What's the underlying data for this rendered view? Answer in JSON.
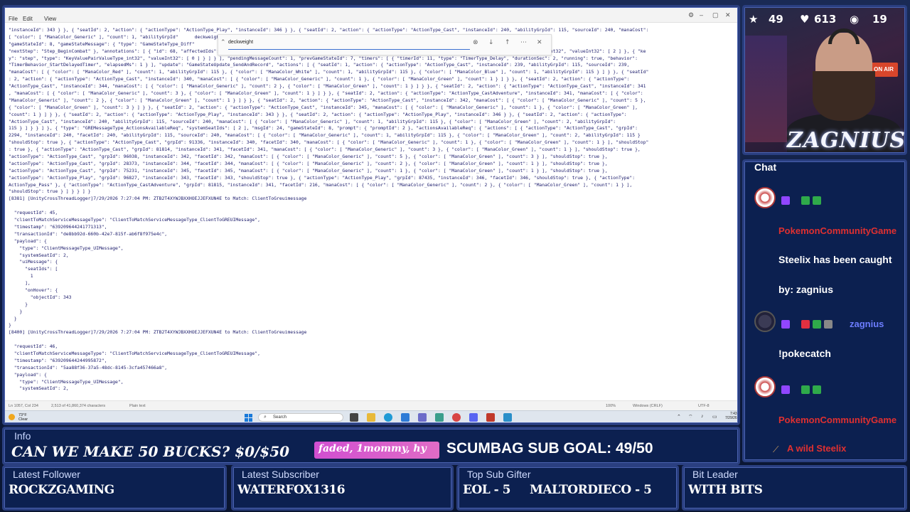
{
  "stream": {
    "stats": {
      "stars": "49",
      "hearts": "613",
      "viewers": "19"
    },
    "cam": {
      "neon_sign": "ZAGNIUS",
      "onair": "ON AIR"
    }
  },
  "notepad": {
    "menu": [
      "File",
      "Edit",
      "View"
    ],
    "find_value": "deckweight",
    "code_lines": [
      "\"instanceId\": 343 } }, { \"seatId\": 2, \"action\": { \"actionType\": \"ActionType_Play\", \"instanceId\": 346 } }, { \"seatId\": 2, \"action\": { \"actionType\": \"ActionType_Cast\", \"instanceId\": 240, \"abilityGrpId\": 115, \"sourceId\": 240, \"manaCost\":",
      "[ \"color\": [ \"ManaColor_Generic\" ], \"count\": 1, \"abilityGrpId\"      deckweight                   \"instanceId\": 240, \"abilityGrpId\": 115, \"sourceId\": 240, \"manaCost\": [ { \"color\":",
      "\"gameStateId\": 8, \"gameStateMessage\": { \"type\": \"GameStateType_Diff\"                            layer\": 2, \"decisionPlayer\": 2, \"nextPhase\": \"Phase_Combat\",",
      "\"nextStep\": \"Step_BeginCombat\" }, \"annotations\": [ { \"id\": 68, \"affectedIds\": [ 2 ], \"type\": [ \"AnnotationType_PhaseOrStepModified\" ], \"details\": [ { \"key\": \"phase\", \"type\": \"KeyValuePairValueType_int32\", \"valueInt32\": [ 2 ] }, { \"ke",
      "y\": \"step\", \"type\": \"KeyValuePairValueType_int32\", \"valueInt32\": [ 0 ] } ] } ], \"pendingMessageCount\": 1, \"prevGameStateId\": 7, \"timers\": [ { \"timerId\": 11, \"type\": \"TimerType_Delay\", \"durationSec\": 2, \"running\": true, \"behavior\":",
      "\"TimerBehavior_StartDelayedTimer\", \"elapsedMs\": 1 } ], \"update\": \"GameStateUpdate_SendAndRecord\", \"actions\": [ { \"seatId\": 1, \"action\": { \"actionType\": \"ActionType_Cast\", \"instanceId\": 239, \"abilityGrpId\": 115, \"sourceId\": 239,",
      "\"manaCost\": [ { \"color\": [ \"ManaColor_Red\" ], \"count\": 1, \"abilityGrpId\": 115 }, { \"color\": [ \"ManaColor_White\" ], \"count\": 1, \"abilityGrpId\": 115 }, { \"color\": [ \"ManaColor_Blue\" ], \"count\": 1, \"abilityGrpId\": 115 } ] } }, { \"seatId\"",
      ": 2, \"action\": { \"actionType\": \"ActionType_Cast\", \"instanceId\": 340, \"manaCost\": [ { \"color\": [ \"ManaColor_Generic\" ], \"count\": 1 }, { \"color\": [ \"ManaColor_Green\" ], \"count\": 1 } ] } }, { \"seatId\": 2, \"action\": { \"actionType\":",
      "\"ActionType_Cast\", \"instanceId\": 344, \"manaCost\": [ { \"color\": [ \"ManaColor_Generic\" ], \"count\": 2 }, { \"color\": [ \"ManaColor_Green\" ], \"count\": 1 } ] } }, { \"seatId\": 2, \"action\": { \"actionType\": \"ActionType_Cast\", \"instanceId\": 341",
      ", \"manaCost\": [ { \"color\": [ \"ManaColor_Generic\" ], \"count\": 3 }, { \"color\": [ \"ManaColor_Green\" ], \"count\": 1 } ] } }, { \"seatId\": 2, \"action\": { \"actionType\": \"ActionType_CastAdventure\", \"instanceId\": 341, \"manaCost\": [ { \"color\":",
      "\"ManaColor_Generic\" ], \"count\": 2 }, { \"color\": [ \"ManaColor_Green\" ], \"count\": 1 } ] } }, { \"seatId\": 2, \"action\": { \"actionType\": \"ActionType_Cast\", \"instanceId\": 342, \"manaCost\": [ { \"color\": [ \"ManaColor_Generic\" ], \"count\": 5 },",
      "{ \"color\": [ \"ManaColor_Green\" ], \"count\": 3 } ] } }, { \"seatId\": 2, \"action\": { \"actionType\": \"ActionType_Cast\", \"instanceId\": 345, \"manaCost\": [ { \"color\": [ \"ManaColor_Generic\" ], \"count\": 1 }, { \"color\": [ \"ManaColor_Green\" ],",
      "\"count\": 1 } ] } }, { \"seatId\": 2, \"action\": { \"actionType\": \"ActionType_Play\", \"instanceId\": 343 } }, { \"seatId\": 2, \"action\": { \"actionType\": \"ActionType_Play\", \"instanceId\": 346 } }, { \"seatId\": 2, \"action\": { \"actionType\":",
      "\"ActionType_Cast\", \"instanceId\": 240, \"abilityGrpId\": 115, \"sourceId\": 240, \"manaCost\": [ { \"color\": [ \"ManaColor_Generic\" ], \"count\": 1, \"abilityGrpId\": 115 }, { \"color\": [ \"ManaColor_Green\" ], \"count\": 2, \"abilityGrpId\":",
      "115 } ] } } ] }, { \"type\": \"GREMessageType_ActionsAvailableReq\", \"systemSeatIds\": [ 2 ], \"msgId\": 24, \"gameStateId\": 8, \"prompt\": { \"promptId\": 2 }, \"actionsAvailableReq\": { \"actions\": [ { \"actionType\": \"ActionType_Cast\", \"grpId\":",
      "2294, \"instanceId\": 240, \"facetId\": 240, \"abilityGrpId\": 115, \"sourceId\": 240, \"manaCost\": [ { \"color\": [ \"ManaColor_Generic\" ], \"count\": 1, \"abilityGrpId\": 115 }, { \"color\": [ \"ManaColor_Green\" ], \"count\": 2, \"abilityGrpId\": 115 }",
      "\"shouldStop\": true }, { \"actionType\": \"ActionType_Cast\", \"grpId\": 91336, \"instanceId\": 340, \"facetId\": 340, \"manaCost\": [ { \"color\": [ \"ManaColor_Generic\" ], \"count\": 1 }, { \"color\": [ \"ManaColor_Green\" ], \"count\": 1 } ], \"shouldStop\"",
      ": true }, { \"actionType\": \"ActionType_Cast\", \"grpId\": 81814, \"instanceId\": 341, \"facetId\": 341, \"manaCost\": [ { \"color\": [ \"ManaColor_Generic\" ], \"count\": 3 }, { \"color\": [ \"ManaColor_Green\" ], \"count\": 1 } ], \"shouldStop\": true },",
      "\"actionType\": \"ActionType_Cast\", \"grpId\": 96038, \"instanceId\": 342, \"facetId\": 342, \"manaCost\": [ { \"color\": [ \"ManaColor_Generic\" ], \"count\": 5 }, { \"color\": [ \"ManaColor_Green\" ], \"count\": 3 } ], \"shouldStop\": true },",
      "\"actionType\": \"ActionType_Cast\", \"grpId\": 28373, \"instanceId\": 344, \"facetId\": 344, \"manaCost\": [ { \"color\": [ \"ManaColor_Generic\" ], \"count\": 2 }, { \"color\": [ \"ManaColor_Green\" ], \"count\": 1 } ], \"shouldStop\": true },",
      "\"actionType\": \"ActionType_Cast\", \"grpId\": 75231, \"instanceId\": 345, \"facetId\": 345, \"manaCost\": [ { \"color\": [ \"ManaColor_Generic\" ], \"count\": 1 }, { \"color\": [ \"ManaColor_Green\" ], \"count\": 1 } ], \"shouldStop\": true },",
      "\"actionType\": \"ActionType_Play\", \"grpId\": 96827, \"instanceId\": 343, \"facetId\": 343, \"shouldStop\": true }, { \"actionType\": \"ActionType_Play\", \"grpId\": 87435, \"instanceId\": 346, \"facetId\": 346, \"shouldStop\": true }, { \"actionType\":",
      "ActionType_Pass\" }, { \"actionType\": \"ActionType_CastAdventure\", \"grpId\": 81815, \"instanceId\": 341, \"facetId\": 216, \"manaCost\": [ { \"color\": [ \"ManaColor_Generic\" ], \"count\": 2 }, { \"color\": [ \"ManaColor_Green\" ], \"count\": 1 } ],",
      "\"shouldStop\": true } ] } } ] }",
      "[8381] [UnityCrossThreadLogger]7/29/2026 7:27:04 PM: ZTB2T4XYWJBXXHOEJJEFXUN4E to Match: ClientToGreuimessage",
      "",
      "  \"requestId\": 45,",
      "  \"clientToMatchServiceMessageType\": \"ClientToMatchServiceMessageType_ClientToGREUIMessage\",",
      "  \"timestamp\": \"639209644241771313\",",
      "  \"transactionId\": \"de8bb92d-660b-42e7-815f-ab6f8f975e4c\",",
      "  \"payload\": {",
      "    \"type\": \"ClientMessageType_UIMessage\",",
      "    \"systemSeatId\": 2,",
      "    \"uiMessage\": {",
      "      \"seatIds\": [",
      "        1",
      "      ],",
      "      \"onHover\": {",
      "        \"objectId\": 343",
      "      }",
      "    }",
      "  }",
      "}",
      "[8400] [UnityCrossThreadLogger]7/29/2026 7:27:04 PM: ZTB2T4XYWJBXXHOEJJEFXUN4E to Match: ClientToGreuimessage",
      "",
      "  \"requestId\": 46,",
      "  \"clientToMatchServiceMessageType\": \"ClientToMatchServiceMessageType_ClientToGREUIMessage\",",
      "  \"timestamp\": \"639209644244995872\",",
      "  \"transactionId\": \"5aa88f36-37a5-48dc-8145-3cfa457466a8\",",
      "  \"payload\": {",
      "    \"type\": \"ClientMessageType_UIMessage\",",
      "    \"systemSeatId\": 2,"
    ],
    "status": {
      "position": "Ln 1057, Col 234",
      "chars": "2,513 of 41,860,374 characters",
      "format": "Plain text",
      "zoom": "100%",
      "eol": "Windows (CRLF)",
      "encoding": "UTF-8"
    }
  },
  "taskbar": {
    "temp": "73°F",
    "weather": "Clear",
    "search_placeholder": "Search",
    "time": "7:43",
    "date": "7/29/26"
  },
  "chat": {
    "title": "Chat",
    "messages": [
      {
        "name": "PokemonCommunityGame",
        "text": "Steelix has been caught"
      },
      {
        "name": "",
        "text": "by: zagnius"
      },
      {
        "name": "zagnius",
        "text": "!pokecatch"
      },
      {
        "name": "PokemonCommunityGame",
        "text": ""
      }
    ],
    "footer": "A wild Steelix"
  },
  "info": {
    "title": "Info",
    "text": "CAN WE MAKE 50 BUCKS? $0/$50",
    "pill": "faded, 1mommy, hy",
    "sub_goal": "SCUMBAG SUB GOAL: 49/50"
  },
  "boxes": [
    {
      "title": "Latest Follower",
      "value": "ROCKZGAMING"
    },
    {
      "title": "Latest Subscriber",
      "value": "WATERFOX1316"
    },
    {
      "title": "Top Sub Gifter",
      "value": "EOL - 5     MALTORDIECO - 5"
    },
    {
      "title": "Bit Leader",
      "value": "WITH BITS"
    }
  ],
  "colors": {
    "accent": "#2a3f80",
    "panel": "#0c2050",
    "chat_name": "#e03030",
    "chat_name_blue": "#6c7dff"
  }
}
